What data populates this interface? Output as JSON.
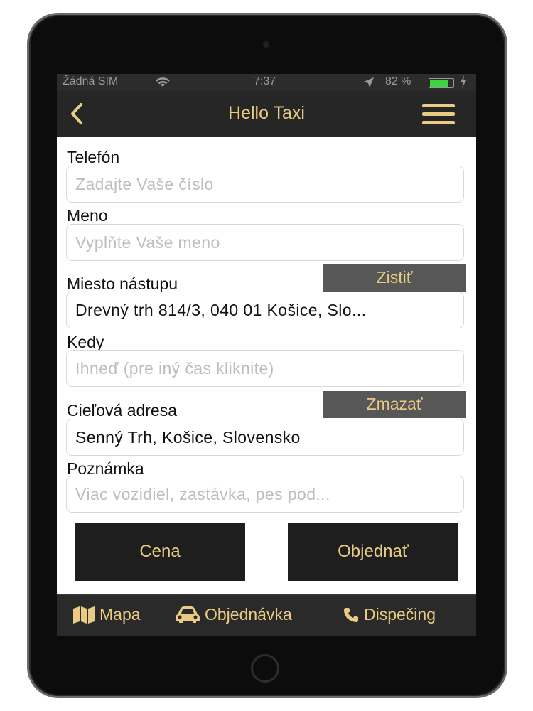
{
  "status_bar": {
    "carrier": "Žádná SIM",
    "time": "7:37",
    "battery_percent": "82 %",
    "battery_level": 0.82
  },
  "nav": {
    "title": "Hello Taxi",
    "back_icon": "chevron-left-icon",
    "menu_icon": "hamburger-menu-icon"
  },
  "form": {
    "phone": {
      "label": "Telefón",
      "placeholder": "Zadajte Vaše číslo"
    },
    "name": {
      "label": "Meno",
      "placeholder": "Vyplňte Vaše meno"
    },
    "pickup": {
      "label": "Miesto nástupu",
      "value": "Drevný trh 814/3, 040 01 Košice, Slo...",
      "action": "Zistiť"
    },
    "when": {
      "label": "Kedy",
      "placeholder": "Ihneď (pre iný čas kliknite)"
    },
    "destination": {
      "label": "Cieľová adresa",
      "value": "Senný Trh, Košice, Slovensko",
      "action": "Zmazať"
    },
    "note": {
      "label": "Poznámka",
      "placeholder": "Viac vozidiel, zastávka, pes pod..."
    }
  },
  "buttons": {
    "price": "Cena",
    "order": "Objednať"
  },
  "tabs": [
    {
      "label": "Mapa",
      "icon": "map-icon"
    },
    {
      "label": "Objednávka",
      "icon": "car-icon"
    },
    {
      "label": "Dispečing",
      "icon": "phone-icon"
    }
  ],
  "colors": {
    "accent": "#e9cb83",
    "dark": "#262626",
    "button": "#1e1e1e",
    "side_button": "#575757"
  }
}
